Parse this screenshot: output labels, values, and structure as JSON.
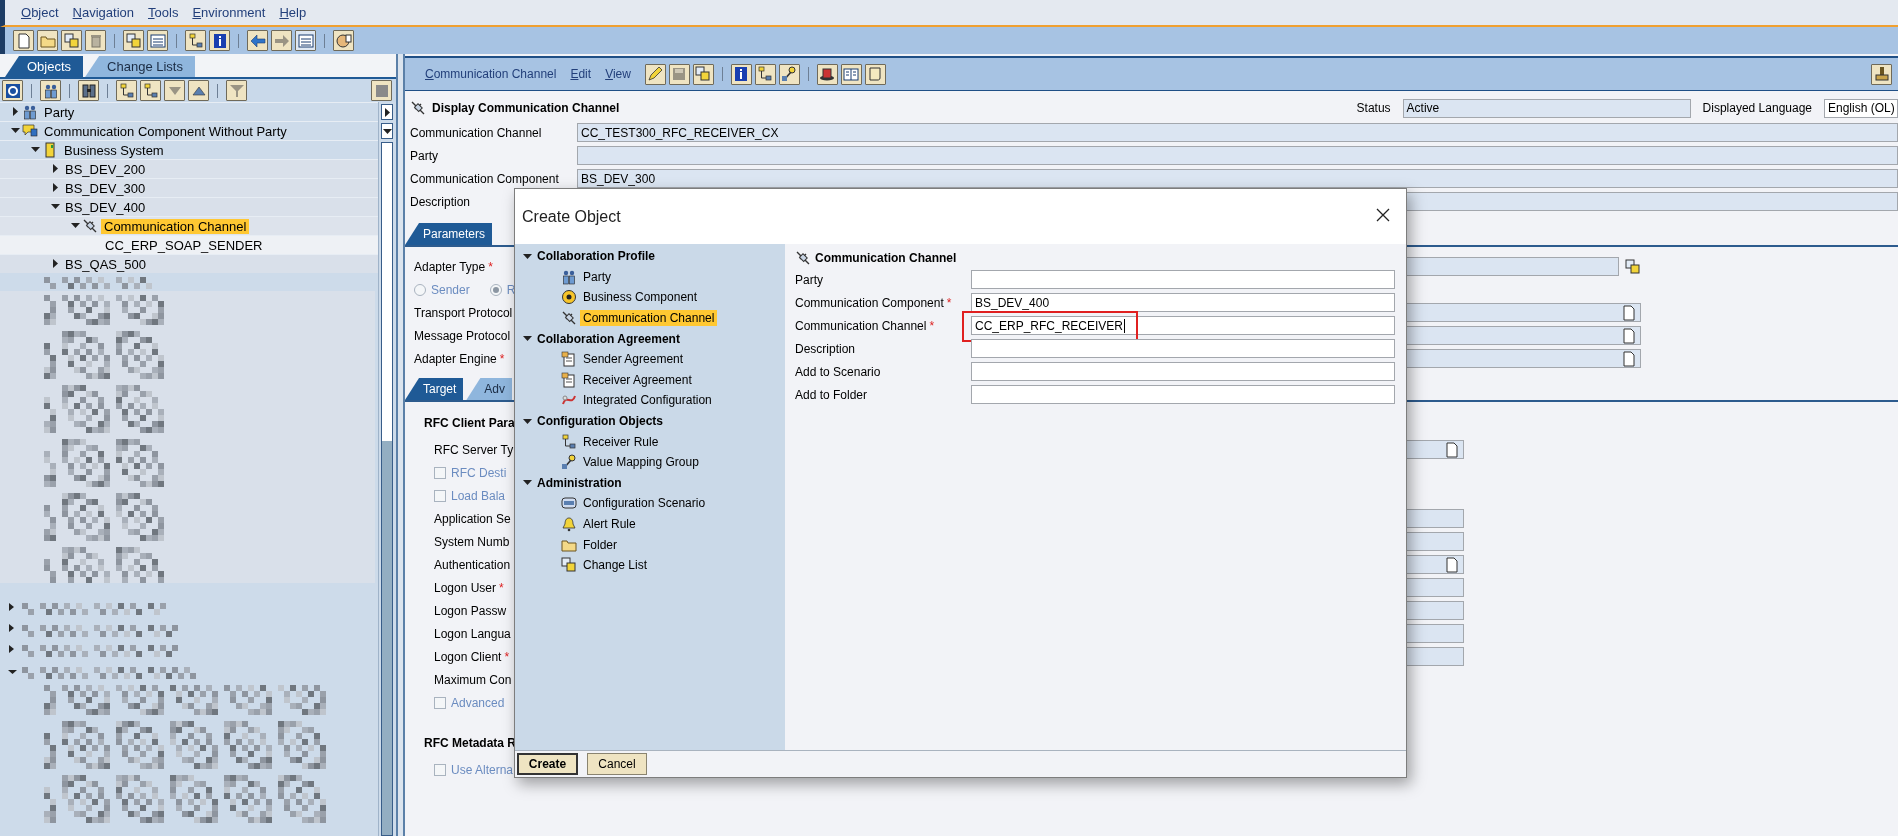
{
  "menu": [
    "Object",
    "Navigation",
    "Tools",
    "Environment",
    "Help"
  ],
  "left_panel": {
    "tabs": [
      {
        "label": "Objects",
        "selected": true
      },
      {
        "label": "Change Lists",
        "selected": false
      }
    ],
    "tree": [
      {
        "label": "Party",
        "kind": "party",
        "expanded": false,
        "selected": false
      },
      {
        "label": "Communication Component Without Party",
        "kind": "component",
        "expanded": true,
        "selected": false,
        "children": [
          {
            "label": "Business System",
            "kind": "system",
            "expanded": true,
            "selected": false,
            "children": [
              {
                "label": "BS_DEV_200",
                "kind": "entry",
                "expanded": false,
                "selected": false
              },
              {
                "label": "BS_DEV_300",
                "kind": "entry",
                "expanded": false,
                "selected": false
              },
              {
                "label": "BS_DEV_400",
                "kind": "entry",
                "expanded": true,
                "selected": false,
                "children": [
                  {
                    "label": "Communication Channel",
                    "kind": "channel",
                    "expanded": true,
                    "selected": true,
                    "children": [
                      {
                        "label": "CC_ERP_SOAP_SENDER",
                        "kind": "object",
                        "selected": false
                      }
                    ]
                  }
                ]
              },
              {
                "label": "BS_QAS_500",
                "kind": "entry",
                "expanded": false,
                "selected": false
              }
            ]
          }
        ]
      }
    ]
  },
  "editor": {
    "menu": [
      "Communication Channel",
      "Edit",
      "View"
    ],
    "title": "Display Communication Channel",
    "status_label": "Status",
    "status": "Active",
    "language_label": "Displayed Language",
    "language": "English (OL)",
    "fields": [
      {
        "label": "Communication Channel",
        "value": "CC_TEST300_RFC_RECEIVER_CX"
      },
      {
        "label": "Party"
      },
      {
        "label": "Communication Component",
        "value": "BS_DEV_300"
      },
      {
        "label": "Description"
      }
    ],
    "tabs": [
      {
        "label": "Parameters",
        "selected": true
      }
    ],
    "adapter_type": {
      "label": "Adapter Type",
      "asterisk": "*"
    },
    "radios": [
      {
        "label": "Sender",
        "selected": false,
        "disabled": true
      },
      {
        "label": "R",
        "selected": true,
        "disabled": true
      }
    ],
    "protocol_rows": [
      {
        "label": "Transport Protocol"
      },
      {
        "label": "Message Protocol"
      },
      {
        "label": "Adapter Engine",
        "asterisk": "*"
      }
    ],
    "subtabs": [
      {
        "label": "Target",
        "selected": true
      },
      {
        "label": "Adv",
        "selected": false
      }
    ],
    "sections": [
      {
        "title": "RFC Client Para",
        "rows": [
          {
            "kind": "dropdown",
            "label": "RFC Server Ty"
          },
          {
            "kind": "checkbox",
            "label": "RFC Desti",
            "checked": false,
            "disabled": true
          },
          {
            "kind": "checkbox",
            "label": "Load Bala",
            "checked": false,
            "disabled": true
          },
          {
            "kind": "field",
            "label": "Application Se"
          },
          {
            "kind": "field",
            "label": "System Numb"
          },
          {
            "kind": "dropdown",
            "label": "Authentication"
          },
          {
            "kind": "field",
            "label": "Logon User",
            "asterisk": "*"
          },
          {
            "kind": "field",
            "label": "Logon Passw"
          },
          {
            "kind": "field",
            "label": "Logon Langua"
          },
          {
            "kind": "field",
            "label": "Logon Client",
            "asterisk": "*"
          },
          {
            "kind": "plain",
            "label": "Maximum Con"
          },
          {
            "kind": "checkbox",
            "label": "Advanced",
            "checked": false,
            "disabled": true
          }
        ]
      },
      {
        "title": "RFC Metadata R",
        "rows": [
          {
            "kind": "checkbox",
            "label": "Use Alterna",
            "checked": false,
            "disabled": true
          }
        ]
      }
    ]
  },
  "dialog": {
    "title": "Create Object",
    "nav": [
      {
        "label": "Collaboration Profile",
        "expanded": true,
        "children": [
          {
            "label": "Party",
            "kind": "party",
            "selected": false
          },
          {
            "label": "Business Component",
            "kind": "target",
            "selected": false
          },
          {
            "label": "Communication Channel",
            "kind": "channel",
            "selected": true
          }
        ]
      },
      {
        "label": "Collaboration Agreement",
        "expanded": true,
        "children": [
          {
            "label": "Sender Agreement",
            "kind": "agreement",
            "selected": false
          },
          {
            "label": "Receiver Agreement",
            "kind": "agreement",
            "selected": false
          },
          {
            "label": "Integrated Configuration",
            "kind": "integrated",
            "selected": false
          }
        ]
      },
      {
        "label": "Configuration Objects",
        "expanded": true,
        "children": [
          {
            "label": "Receiver Rule",
            "kind": "rule",
            "selected": false
          },
          {
            "label": "Value Mapping Group",
            "kind": "mapping",
            "selected": false
          }
        ]
      },
      {
        "label": "Administration",
        "expanded": true,
        "children": [
          {
            "label": "Configuration Scenario",
            "kind": "scenario",
            "selected": false
          },
          {
            "label": "Alert Rule",
            "kind": "alert",
            "selected": false
          },
          {
            "label": "Folder",
            "kind": "folder",
            "selected": false
          },
          {
            "label": "Change List",
            "kind": "changelist",
            "selected": false
          }
        ]
      }
    ],
    "form_title": "Communication Channel",
    "fields": [
      {
        "label": "Party",
        "highlighted": false
      },
      {
        "label": "Communication Component",
        "asterisk": "*",
        "value": "BS_DEV_400",
        "highlighted": false
      },
      {
        "label": "Communication Channel",
        "asterisk": "*",
        "value": "CC_ERP_RFC_RECEIVER",
        "highlighted": true
      },
      {
        "label": "Description",
        "highlighted": false
      },
      {
        "label": "Add to Scenario",
        "highlighted": false
      },
      {
        "label": "Add to Folder",
        "highlighted": false
      }
    ],
    "buttons": [
      {
        "label": "Create",
        "default": true
      },
      {
        "label": "Cancel",
        "default": false
      }
    ]
  }
}
